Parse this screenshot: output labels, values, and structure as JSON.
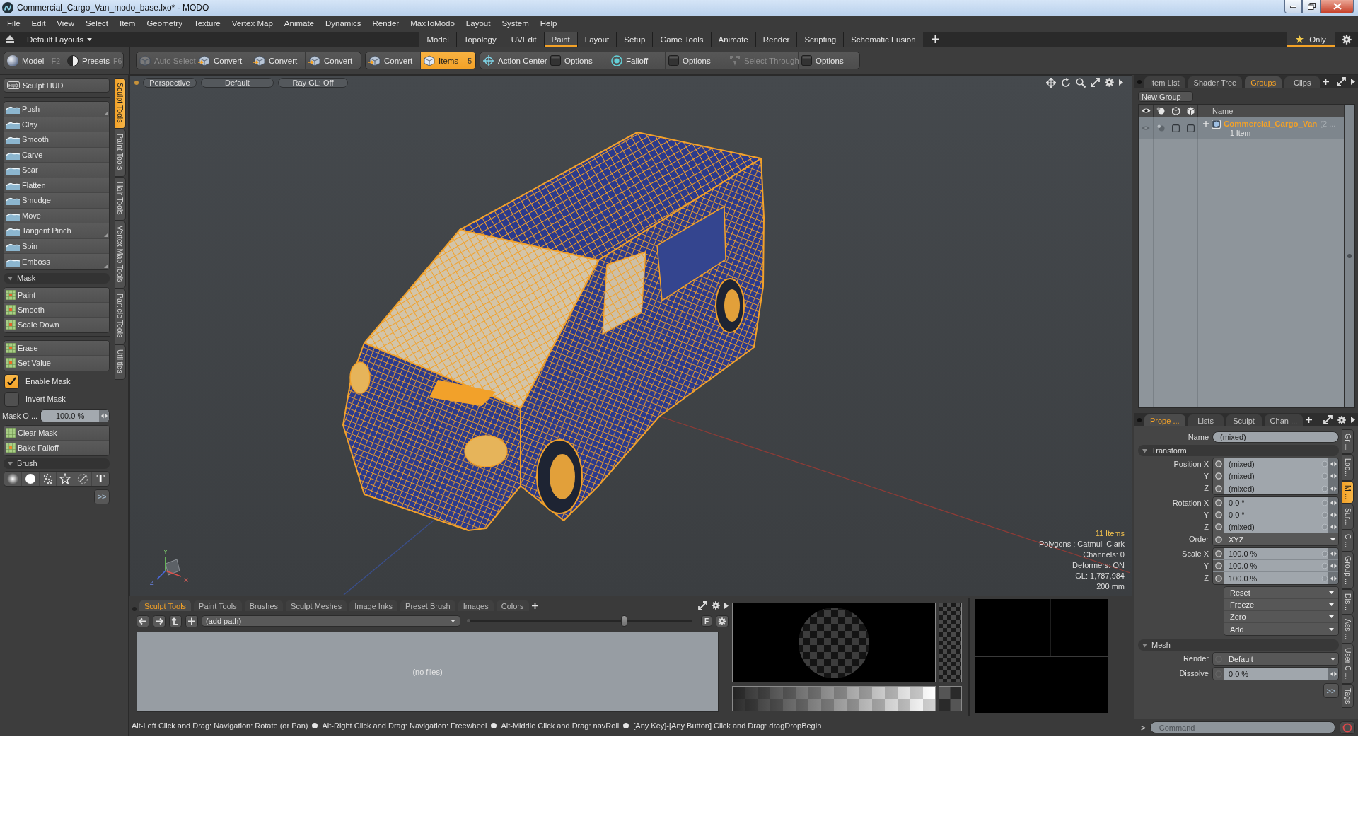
{
  "window": {
    "title": "Commercial_Cargo_Van_modo_base.lxo* - MODO"
  },
  "menu": [
    "File",
    "Edit",
    "View",
    "Select",
    "Item",
    "Geometry",
    "Texture",
    "Vertex Map",
    "Animate",
    "Dynamics",
    "Render",
    "MaxToModo",
    "Layout",
    "System",
    "Help"
  ],
  "layout_bar": {
    "layouts": "Default Layouts",
    "tabs": [
      {
        "label": "Model",
        "selected": false
      },
      {
        "label": "Topology",
        "selected": false
      },
      {
        "label": "UVEdit",
        "selected": false
      },
      {
        "label": "Paint",
        "selected": true
      },
      {
        "label": "Layout",
        "selected": false
      },
      {
        "label": "Setup",
        "selected": false
      },
      {
        "label": "Game Tools",
        "selected": false
      },
      {
        "label": "Animate",
        "selected": false
      },
      {
        "label": "Render",
        "selected": false
      },
      {
        "label": "Scripting",
        "selected": false
      },
      {
        "label": "Schematic Fusion",
        "selected": false
      }
    ],
    "filter": {
      "label": "Only",
      "on": true
    }
  },
  "toolbar": {
    "groups": [
      [
        {
          "kind": "model",
          "label": "Model",
          "shortcut": "F2",
          "selected": false,
          "disabled": false
        },
        {
          "kind": "presets",
          "label": "Presets",
          "shortcut": "F6",
          "selected": false,
          "disabled": false
        }
      ],
      [
        {
          "kind": "auto_select",
          "label": "Auto Select",
          "selected": false,
          "disabled": true
        },
        {
          "kind": "convert",
          "label": "Convert",
          "selected": false,
          "disabled": false
        },
        {
          "kind": "convert",
          "label": "Convert",
          "selected": false,
          "disabled": false
        },
        {
          "kind": "convert",
          "label": "Convert",
          "selected": false,
          "disabled": false
        }
      ],
      [
        {
          "kind": "convert",
          "label": "Convert",
          "selected": false,
          "disabled": false
        },
        {
          "kind": "items",
          "label": "Items",
          "count": "5",
          "selected": true,
          "disabled": false
        }
      ],
      [
        {
          "kind": "action_center",
          "label": "Action Center",
          "selected": false,
          "disabled": false
        },
        {
          "kind": "options",
          "label": "Options",
          "selected": false,
          "disabled": false
        },
        {
          "kind": "falloff",
          "label": "Falloff",
          "selected": false,
          "disabled": false
        },
        {
          "kind": "options",
          "label": "Options",
          "selected": false,
          "disabled": false
        },
        {
          "kind": "select_through",
          "label": "Select Through",
          "selected": false,
          "disabled": true
        },
        {
          "kind": "options",
          "label": "Options",
          "selected": false,
          "disabled": false
        }
      ]
    ]
  },
  "sculpt_panel": {
    "hud_button": "Sculpt HUD",
    "tools": [
      {
        "label": "Push",
        "submenu": true
      },
      {
        "label": "Clay",
        "submenu": false
      },
      {
        "label": "Smooth",
        "submenu": false
      },
      {
        "label": "Carve",
        "submenu": false
      },
      {
        "label": "Scar",
        "submenu": false
      },
      {
        "label": "Flatten",
        "submenu": false
      },
      {
        "label": "Smudge",
        "submenu": false
      },
      {
        "label": "Move",
        "submenu": false
      },
      {
        "label": "Tangent Pinch",
        "submenu": true
      },
      {
        "label": "Spin",
        "submenu": false
      },
      {
        "label": "Emboss",
        "submenu": true
      }
    ]
  },
  "mask": {
    "title": "Mask",
    "expanded": true,
    "tools": [
      "Paint",
      "Smooth",
      "Scale Down"
    ],
    "edit_tools": [
      "Erase",
      "Set Value"
    ],
    "toggles": [
      {
        "label": "Enable Mask",
        "checked": true
      },
      {
        "label": "Invert Mask",
        "checked": false
      }
    ],
    "opacity": {
      "label": "Mask O ...",
      "value": "100.0 %"
    },
    "actions": [
      "Clear Mask",
      "Bake Falloff"
    ]
  },
  "brush": {
    "title": "Brush",
    "expanded": true,
    "presets": [
      {
        "kind": "soft"
      },
      {
        "kind": "hard"
      },
      {
        "kind": "scatter"
      },
      {
        "kind": "star"
      },
      {
        "kind": "procedural"
      },
      {
        "kind": "text",
        "label": "T"
      }
    ],
    "more": ">>"
  },
  "side_tabs": [
    {
      "label": "Sculpt Tools",
      "selected": true
    },
    {
      "label": "Paint Tools",
      "selected": false
    },
    {
      "label": "Hair Tools",
      "selected": false
    },
    {
      "label": "Vertex Map Tools",
      "selected": false
    },
    {
      "label": "Particle Tools",
      "selected": false
    },
    {
      "label": "Utilities",
      "selected": false
    }
  ],
  "viewport": {
    "buttons": [
      "Perspective",
      "Default",
      "Ray GL: Off"
    ],
    "axes": [
      "Y",
      "X",
      "Z"
    ],
    "info": {
      "title": "11 Items",
      "lines": [
        "Polygons : Catmull-Clark",
        "Channels: 0",
        "Deformers: ON",
        "GL: 1,787,984",
        "200 mm"
      ]
    }
  },
  "browser": {
    "tabs": [
      {
        "label": "Sculpt Tools",
        "selected": true
      },
      {
        "label": "Paint Tools",
        "selected": false
      },
      {
        "label": "Brushes",
        "selected": false
      },
      {
        "label": "Sculpt Meshes",
        "selected": false
      },
      {
        "label": "Image Inks",
        "selected": false
      },
      {
        "label": "Preset Brush",
        "selected": false
      },
      {
        "label": "Images",
        "selected": false
      },
      {
        "label": "Colors",
        "selected": false
      }
    ],
    "path": "(add path)",
    "zoom": {
      "level": 0.69
    },
    "filter_button": "F",
    "empty_text": "(no files)"
  },
  "status_bar": {
    "hints": [
      "Alt-Left Click and Drag: Navigation: Rotate (or Pan)",
      "Alt-Right Click and Drag: Navigation: Freewheel",
      "Alt-Middle Click and Drag: navRoll",
      "[Any Key]-[Any Button] Click and Drag: dragDropBegin"
    ]
  },
  "item_panel": {
    "tabs": [
      {
        "label": "Item List",
        "selected": false
      },
      {
        "label": "Shader Tree",
        "selected": false
      },
      {
        "label": "Groups",
        "selected": true
      },
      {
        "label": "Clips",
        "selected": false
      }
    ],
    "new_group": "New Group",
    "name_column": "Name",
    "groups": [
      {
        "name": "Commercial_Cargo_Van",
        "count": "(2 ...",
        "detail": "1 Item",
        "expanded": false
      }
    ]
  },
  "properties": {
    "tabs": [
      {
        "label": "Prope ...",
        "selected": true
      },
      {
        "label": "Lists",
        "selected": false
      },
      {
        "label": "Sculpt",
        "selected": false
      },
      {
        "label": "Chan ...",
        "selected": false
      }
    ],
    "name": {
      "label": "Name",
      "value": "(mixed)"
    },
    "sections": [
      {
        "title": "Transform",
        "expanded": true,
        "blocks": [
          {
            "kind": "fields",
            "fields": [
              {
                "kind": "number",
                "label": "Position X",
                "value": "(mixed)",
                "keyable": true
              },
              {
                "kind": "number",
                "label": "Y",
                "value": "(mixed)",
                "keyable": true
              },
              {
                "kind": "number",
                "label": "Z",
                "value": "(mixed)",
                "keyable": true
              }
            ]
          },
          {
            "kind": "fields",
            "fields": [
              {
                "kind": "number",
                "label": "Rotation X",
                "value": "0.0 °",
                "keyable": true
              },
              {
                "kind": "number",
                "label": "Y",
                "value": "0.0 °",
                "keyable": true
              },
              {
                "kind": "number",
                "label": "Z",
                "value": "(mixed)",
                "keyable": true
              },
              {
                "kind": "dropdown",
                "label": "Order",
                "value": "XYZ",
                "keyable": true
              }
            ]
          },
          {
            "kind": "fields",
            "fields": [
              {
                "kind": "number",
                "label": "Scale X",
                "value": "100.0 %",
                "keyable": true
              },
              {
                "kind": "number",
                "label": "Y",
                "value": "100.0 %",
                "keyable": true
              },
              {
                "kind": "number",
                "label": "Z",
                "value": "100.0 %",
                "keyable": true
              }
            ]
          },
          {
            "kind": "actions",
            "items": [
              "Reset",
              "Freeze",
              "Zero",
              "Add"
            ]
          }
        ]
      },
      {
        "title": "Mesh",
        "expanded": true,
        "blocks": [
          {
            "kind": "fields",
            "fields": [
              {
                "kind": "dropdown",
                "label": "Render",
                "value": "Default",
                "keyable": false
              }
            ]
          },
          {
            "kind": "fields",
            "fields": [
              {
                "kind": "number",
                "label": "Dissolve",
                "value": "0.0 %",
                "keyable": false
              }
            ]
          }
        ]
      }
    ],
    "more": ">>",
    "side_tabs": [
      {
        "label": "Gr ...",
        "selected": false
      },
      {
        "label": "Loc...",
        "selected": false
      },
      {
        "label": "M ...",
        "selected": true
      },
      {
        "label": "Sur...",
        "selected": false
      },
      {
        "label": "C ...",
        "selected": false
      },
      {
        "label": "Group ...",
        "selected": false
      },
      {
        "label": "Dis...",
        "selected": false
      },
      {
        "label": "Ass ...",
        "selected": false
      },
      {
        "label": "User C ...",
        "selected": false
      },
      {
        "label": "Tags",
        "selected": false
      }
    ]
  },
  "command": {
    "prompt": ">",
    "placeholder": "Command"
  }
}
